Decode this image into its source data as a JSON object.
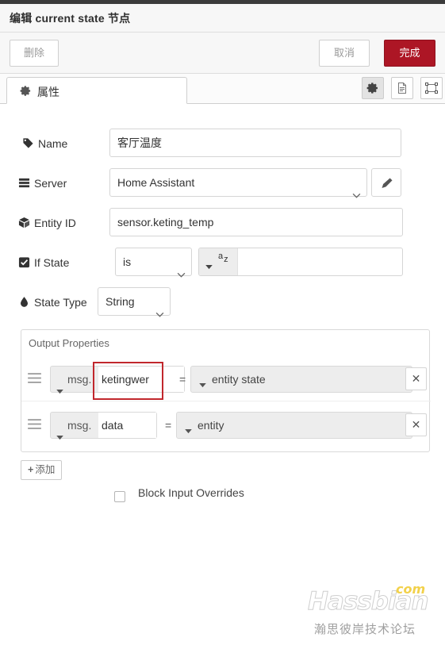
{
  "dialog": {
    "title": "编辑 current state 节点"
  },
  "actions": {
    "delete_label": "删除",
    "cancel_label": "取消",
    "done_label": "完成",
    "done_color": "#ad1625"
  },
  "tabs": {
    "active": "属性",
    "items": [
      {
        "label": "属性",
        "icon": "gear-icon"
      }
    ],
    "icon_buttons": [
      {
        "name": "gear-icon",
        "active": true
      },
      {
        "name": "document-icon",
        "active": false
      },
      {
        "name": "expand-icon",
        "active": false
      }
    ]
  },
  "form": {
    "name": {
      "label": "Name",
      "icon": "tag-icon",
      "value": "客厅温度",
      "placeholder": "Name"
    },
    "server": {
      "label": "Server",
      "icon": "server-icon",
      "value": "Home Assistant",
      "edit_icon": "pencil-icon"
    },
    "entity_id": {
      "label": "Entity ID",
      "icon": "cube-icon",
      "value": "sensor.keting_temp",
      "placeholder": "Entity ID"
    },
    "if_state": {
      "label": "If State",
      "icon": "checked-checkbox-icon",
      "checked": true,
      "comparator": "is",
      "value": "",
      "value_type": "str",
      "type_icon": "az-icon"
    },
    "state_type": {
      "label": "State Type",
      "icon": "droplet-icon",
      "value": "String"
    }
  },
  "output_properties": {
    "legend": "Output Properties",
    "rows": [
      {
        "drag_icon": "drag-handle-icon",
        "key_prefix": "msg.",
        "key_value": "ketingwer",
        "equals": "=",
        "value_label": "entity state",
        "remove_icon": "close-icon",
        "highlighted": true
      },
      {
        "drag_icon": "drag-handle-icon",
        "key_prefix": "msg.",
        "key_value": "data",
        "equals": "=",
        "value_label": "entity",
        "remove_icon": "close-icon",
        "highlighted": false
      }
    ],
    "add_label": "添加",
    "add_icon": "plus-icon"
  },
  "block_input_overrides": {
    "label": "Block Input Overrides",
    "checked": false
  },
  "annotation": {
    "color": "#c1272d",
    "target": "output-property-key-input-0"
  },
  "watermark": {
    "brand": "Hassbian",
    "tld": "com",
    "subtitle": "瀚思彼岸技术论坛"
  }
}
